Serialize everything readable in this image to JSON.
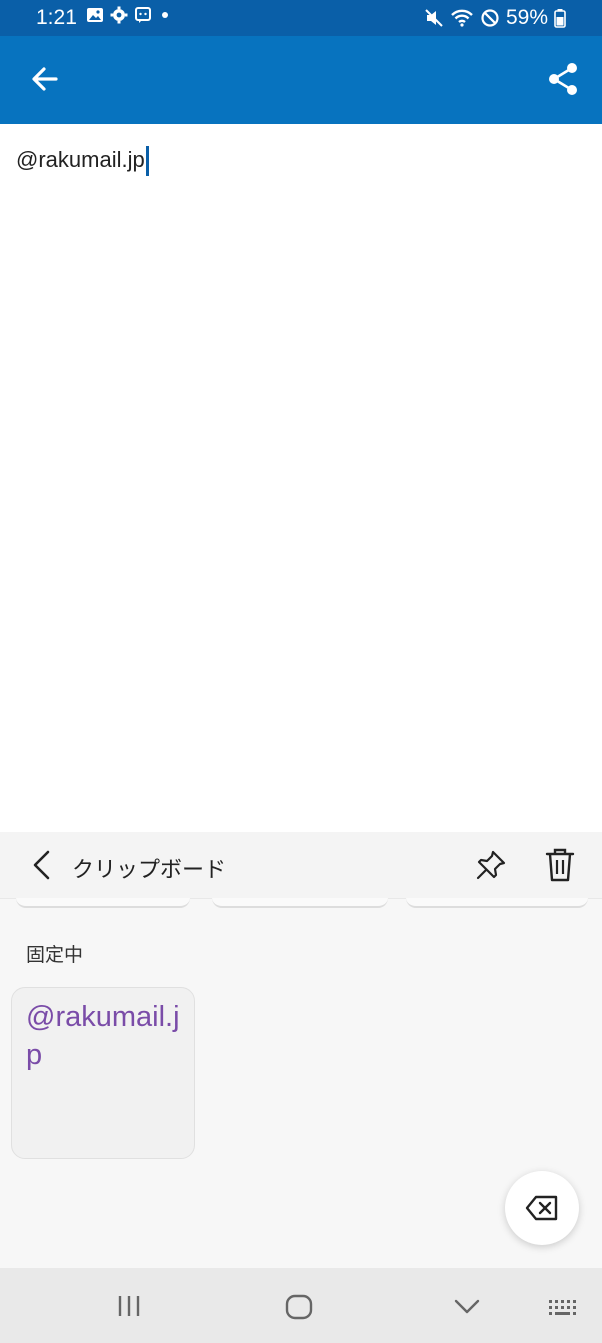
{
  "status_bar": {
    "time": "1:21",
    "battery_text": "59%",
    "left_icons": [
      "image-icon",
      "gear-icon",
      "message-icon",
      "dot-icon"
    ],
    "right_icons": [
      "mute-icon",
      "wifi-icon",
      "no-disturb-icon",
      "battery-icon"
    ]
  },
  "app_bar": {
    "back_icon": "arrow-left-icon",
    "share_icon": "share-icon",
    "color": "#0773bf"
  },
  "editor": {
    "text": "@rakumail.jp"
  },
  "clipboard": {
    "title": "クリップボード",
    "pin_icon": "pin-icon",
    "delete_icon": "trash-icon",
    "section_pinned": "固定中",
    "pinned_items": [
      {
        "text": "@rakumail.jp"
      }
    ]
  },
  "keyboard": {
    "backspace_icon": "backspace-icon"
  },
  "nav_bar": {
    "items": [
      "recent-apps-icon",
      "home-icon",
      "back-chevron-icon",
      "keyboard-icon"
    ]
  }
}
